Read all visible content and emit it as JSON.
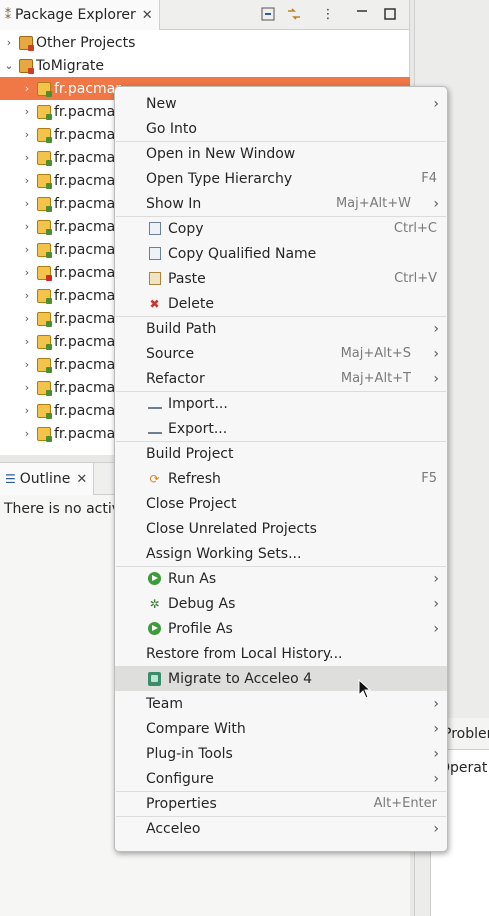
{
  "package_explorer": {
    "tab_label": "Package Explorer",
    "tree": [
      {
        "label": "Other Projects",
        "expanded": false,
        "type": "working-set"
      },
      {
        "label": "ToMigrate",
        "expanded": true,
        "type": "working-set"
      },
      {
        "label": "fr.pacmar",
        "selected": true,
        "type": "project"
      },
      {
        "label": "fr.pacma",
        "type": "project"
      },
      {
        "label": "fr.pacma",
        "type": "project"
      },
      {
        "label": "fr.pacma",
        "type": "project"
      },
      {
        "label": "fr.pacma",
        "type": "project"
      },
      {
        "label": "fr.pacma",
        "type": "project"
      },
      {
        "label": "fr.pacma",
        "type": "project"
      },
      {
        "label": "fr.pacma",
        "type": "project"
      },
      {
        "label": "fr.pacma",
        "type": "project-error"
      },
      {
        "label": "fr.pacma",
        "type": "project"
      },
      {
        "label": "fr.pacma",
        "type": "project"
      },
      {
        "label": "fr.pacma",
        "type": "project"
      },
      {
        "label": "fr.pacma",
        "type": "project"
      },
      {
        "label": "fr.pacma",
        "type": "project"
      },
      {
        "label": "fr.pacma",
        "type": "project"
      },
      {
        "label": "fr.pacma",
        "type": "project"
      }
    ]
  },
  "outline": {
    "tab_label": "Outline",
    "message": "There is no active"
  },
  "problems": {
    "tab_label": "Problen",
    "column_text": "Operat"
  },
  "context_menu": {
    "items": [
      {
        "label": "New",
        "submenu": true
      },
      {
        "label": "Go Into"
      },
      {
        "sep": true
      },
      {
        "label": "Open in New Window"
      },
      {
        "label": "Open Type Hierarchy",
        "accel": "F4"
      },
      {
        "label": "Show In",
        "accel": "Maj+Alt+W",
        "submenu": true
      },
      {
        "sep": true
      },
      {
        "label": "Copy",
        "accel": "Ctrl+C",
        "icon": "copy-icon"
      },
      {
        "label": "Copy Qualified Name",
        "icon": "copy-qualified-icon"
      },
      {
        "label": "Paste",
        "accel": "Ctrl+V",
        "icon": "paste-icon"
      },
      {
        "label": "Delete",
        "icon": "delete-icon"
      },
      {
        "sep": true
      },
      {
        "label": "Build Path",
        "submenu": true
      },
      {
        "label": "Source",
        "accel": "Maj+Alt+S",
        "submenu": true
      },
      {
        "label": "Refactor",
        "accel": "Maj+Alt+T",
        "submenu": true
      },
      {
        "sep": true
      },
      {
        "label": "Import...",
        "icon": "import-icon"
      },
      {
        "label": "Export...",
        "icon": "export-icon"
      },
      {
        "sep": true
      },
      {
        "label": "Build Project"
      },
      {
        "label": "Refresh",
        "accel": "F5",
        "icon": "refresh-icon"
      },
      {
        "label": "Close Project"
      },
      {
        "label": "Close Unrelated Projects"
      },
      {
        "label": "Assign Working Sets..."
      },
      {
        "sep": true
      },
      {
        "label": "Run As",
        "submenu": true,
        "icon": "run-icon"
      },
      {
        "label": "Debug As",
        "submenu": true,
        "icon": "debug-icon"
      },
      {
        "label": "Profile As",
        "submenu": true,
        "icon": "profile-icon"
      },
      {
        "label": "Restore from Local History..."
      },
      {
        "label": "Migrate to Acceleo 4",
        "icon": "migrate-icon",
        "hover": true
      },
      {
        "label": "Team",
        "submenu": true
      },
      {
        "label": "Compare With",
        "submenu": true
      },
      {
        "label": "Plug-in Tools",
        "submenu": true
      },
      {
        "label": "Configure",
        "submenu": true
      },
      {
        "sep": true
      },
      {
        "label": "Properties",
        "accel": "Alt+Enter"
      },
      {
        "sep": true
      },
      {
        "label": "Acceleo",
        "submenu": true
      }
    ]
  },
  "colors": {
    "selection": "#f07746",
    "menu_background": "#f7f7f7",
    "menu_hover": "#dededc"
  }
}
